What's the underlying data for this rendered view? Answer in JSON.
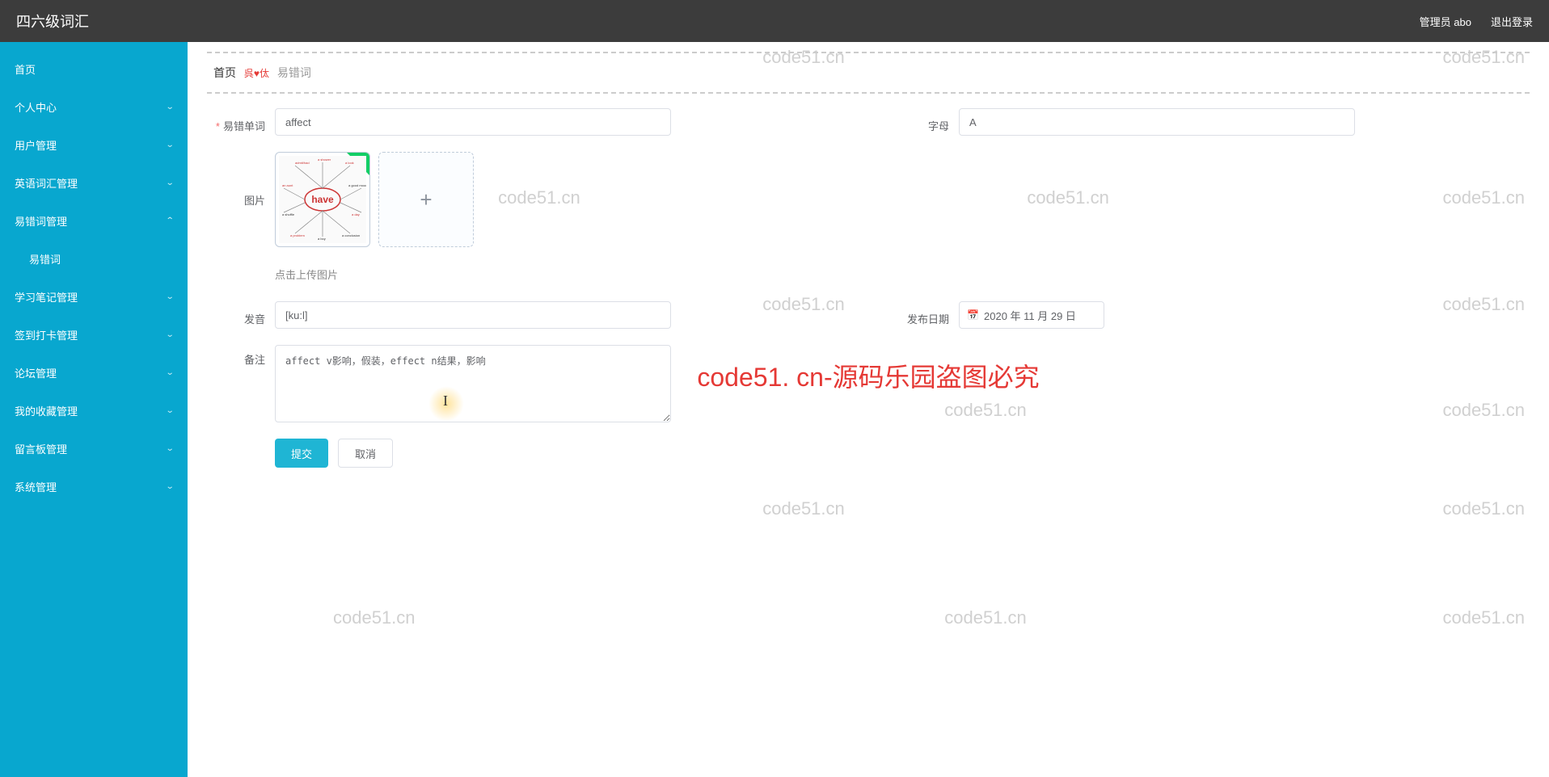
{
  "header": {
    "title": "四六级词汇",
    "admin_label": "管理员 abo",
    "logout_label": "退出登录"
  },
  "sidebar": {
    "items": [
      {
        "label": "首页",
        "expandable": false
      },
      {
        "label": "个人中心",
        "expandable": true
      },
      {
        "label": "用户管理",
        "expandable": true
      },
      {
        "label": "英语词汇管理",
        "expandable": true
      },
      {
        "label": "易错词管理",
        "expandable": true,
        "expanded": true
      },
      {
        "label": "易错词",
        "sub": true
      },
      {
        "label": "学习笔记管理",
        "expandable": true
      },
      {
        "label": "签到打卡管理",
        "expandable": true
      },
      {
        "label": "论坛管理",
        "expandable": true
      },
      {
        "label": "我的收藏管理",
        "expandable": true
      },
      {
        "label": "留言板管理",
        "expandable": true
      },
      {
        "label": "系统管理",
        "expandable": true
      }
    ]
  },
  "breadcrumb": {
    "home": "首页",
    "sep": "呉♥㑀",
    "current": "易错词"
  },
  "form": {
    "word_label": "易错单词",
    "word_value": "affect",
    "letter_label": "字母",
    "letter_value": "A",
    "image_label": "图片",
    "thumb_center": "have",
    "upload_tip": "点击上传图片",
    "pron_label": "发音",
    "pron_value": "[ku:l]",
    "date_label": "发布日期",
    "date_value": "2020 年 11 月 29 日",
    "remark_label": "备注",
    "remark_value": "affect v影响，假装，effect n结果，影响",
    "submit": "提交",
    "cancel": "取消"
  },
  "watermark": {
    "text": "code51.cn",
    "large": "code51. cn-源码乐园盗图必究"
  }
}
